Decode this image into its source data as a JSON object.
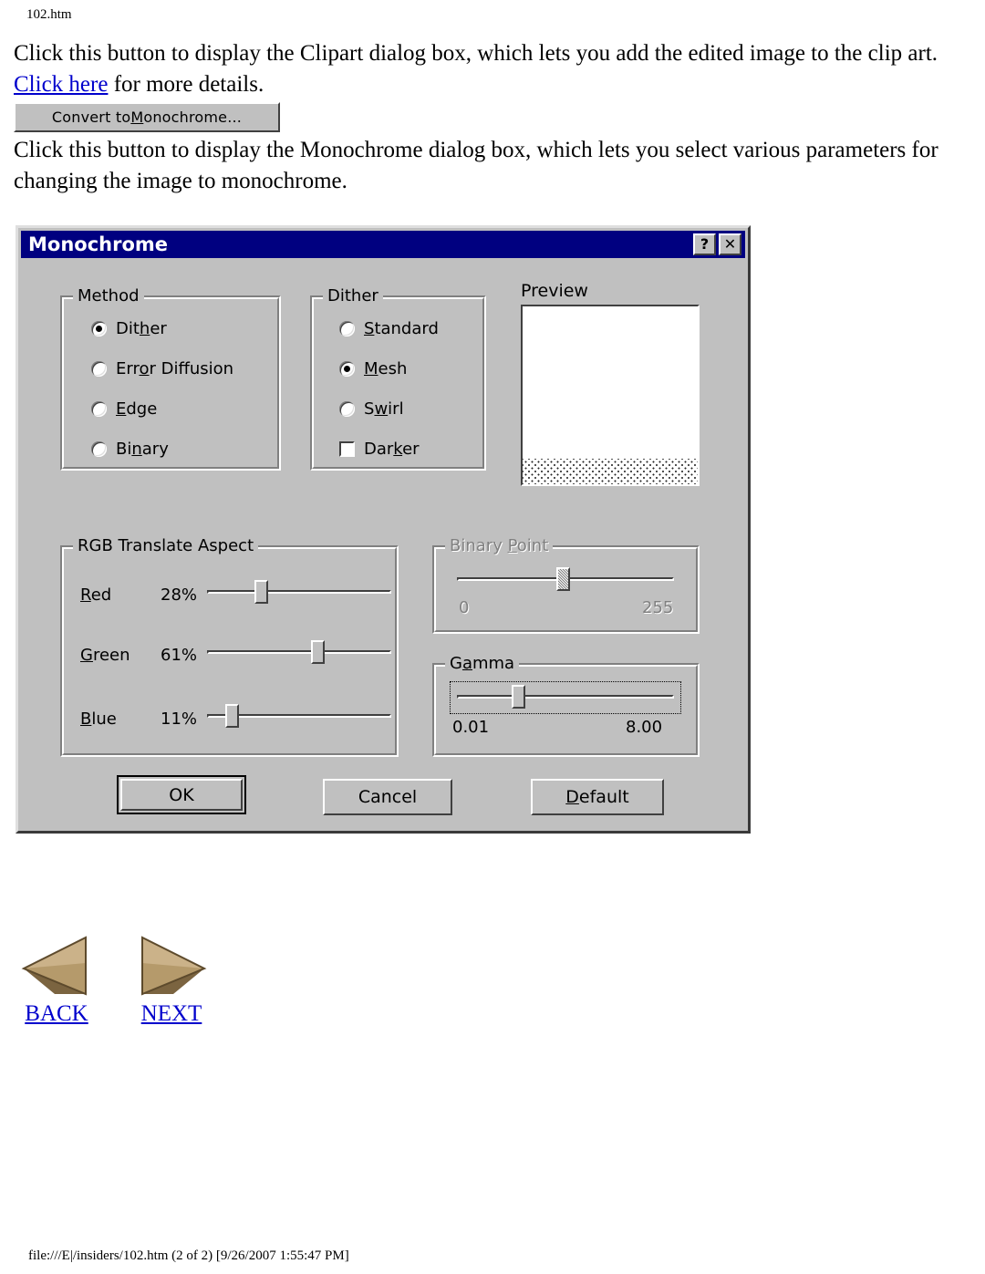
{
  "page": {
    "header": "102.htm",
    "footer": "file:///E|/insiders/102.htm (2 of 2) [9/26/2007 1:55:47 PM]"
  },
  "content": {
    "paragraph1_before_link": "Click this button to display the Clipart dialog box, which lets you add the edited image to the clip art. ",
    "link_text": "Click here",
    "paragraph1_after_link": " for more details.",
    "convert_button": {
      "label_before": "Convert to ",
      "accel": "M",
      "label_after": "onochrome..."
    },
    "paragraph2": "Click this button to display the Monochrome dialog box, which lets you select various parameters for changing the image to monochrome."
  },
  "dialog": {
    "title": "Monochrome",
    "titlebar_buttons": [
      {
        "name": "help",
        "glyph": "?"
      },
      {
        "name": "close",
        "glyph": "✕"
      }
    ],
    "method_group": {
      "label": "Method",
      "options": [
        {
          "label": "Dit",
          "accel": "h",
          "label_after": "er",
          "selected": true
        },
        {
          "label": "Err",
          "accel": "o",
          "label_after": "r Diffusion",
          "selected": false
        },
        {
          "label": "",
          "accel": "E",
          "label_after": "dge",
          "selected": false
        },
        {
          "label": "Bi",
          "accel": "n",
          "label_after": "ary",
          "selected": false
        }
      ]
    },
    "dither_group": {
      "label": "Dither",
      "options": [
        {
          "label": "",
          "accel": "S",
          "label_after": "tandard",
          "selected": false,
          "type": "radio"
        },
        {
          "label": "",
          "accel": "M",
          "label_after": "esh",
          "selected": true,
          "type": "radio"
        },
        {
          "label": "S",
          "accel": "w",
          "label_after": "irl",
          "selected": false,
          "type": "radio"
        },
        {
          "label": "Dar",
          "accel": "k",
          "label_after": "er",
          "selected": false,
          "type": "checkbox"
        }
      ]
    },
    "preview": {
      "label": "Preview"
    },
    "rgb_group": {
      "label": "RGB Translate Aspect",
      "sliders": [
        {
          "accel": "R",
          "label_after": "ed",
          "value": "28%",
          "percent": 28
        },
        {
          "accel": "G",
          "label_after": "reen",
          "value": "61%",
          "percent": 61
        },
        {
          "accel": "B",
          "label_after": "lue",
          "value": "11%",
          "percent": 11
        }
      ]
    },
    "binary_point_group": {
      "label_before": "Binary ",
      "accel": "P",
      "label_after": "oint",
      "disabled": true,
      "min_label": "0",
      "max_label": "255",
      "percent": 50
    },
    "gamma_group": {
      "label_before": "G",
      "accel": "a",
      "label_after": "mma",
      "disabled": false,
      "min_label": "0.01",
      "max_label": "8.00",
      "percent": 28,
      "focused": true
    },
    "buttons": [
      {
        "name": "ok",
        "label": "OK",
        "accel": "",
        "default": true
      },
      {
        "name": "cancel",
        "label": "Cancel",
        "accel": "",
        "default": false
      },
      {
        "name": "default",
        "label_before": "",
        "accel": "D",
        "label_after": "efault",
        "default": false
      }
    ]
  },
  "nav": {
    "back_label": "BACK",
    "next_label": "NEXT"
  },
  "colors": {
    "titlebar": "#000080",
    "face": "#c0c0c0",
    "link": "#0000cc",
    "arrow_light": "#d8c49a",
    "arrow_mid": "#a98f63",
    "arrow_dark": "#6f5a38"
  }
}
